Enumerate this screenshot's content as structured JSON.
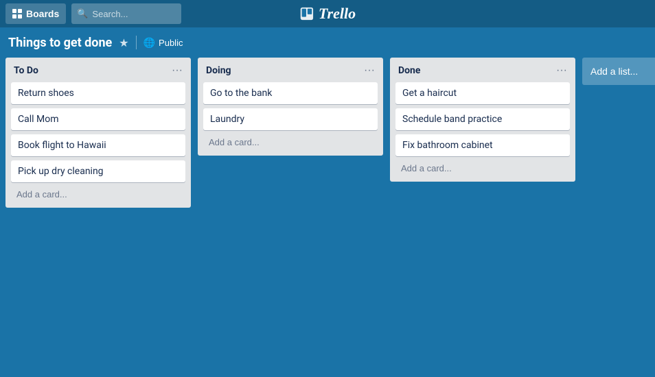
{
  "app": {
    "name": "Trello"
  },
  "topnav": {
    "boards_label": "Boards",
    "search_placeholder": "Search...",
    "logo_text": "Trello"
  },
  "board": {
    "title": "Things to get done",
    "visibility": "Public"
  },
  "lists": [
    {
      "id": "todo",
      "title": "To Do",
      "cards": [
        {
          "id": "c1",
          "text": "Return shoes"
        },
        {
          "id": "c2",
          "text": "Call Mom"
        },
        {
          "id": "c3",
          "text": "Book flight to Hawaii"
        },
        {
          "id": "c4",
          "text": "Pick up dry cleaning"
        }
      ],
      "add_card_label": "Add a card..."
    },
    {
      "id": "doing",
      "title": "Doing",
      "cards": [
        {
          "id": "c5",
          "text": "Go to the bank"
        },
        {
          "id": "c6",
          "text": "Laundry"
        }
      ],
      "add_card_label": "Add a card..."
    },
    {
      "id": "done",
      "title": "Done",
      "cards": [
        {
          "id": "c7",
          "text": "Get a haircut"
        },
        {
          "id": "c8",
          "text": "Schedule band practice"
        },
        {
          "id": "c9",
          "text": "Fix bathroom cabinet"
        }
      ],
      "add_card_label": "Add a card..."
    }
  ],
  "add_list_label": "Add a list..."
}
